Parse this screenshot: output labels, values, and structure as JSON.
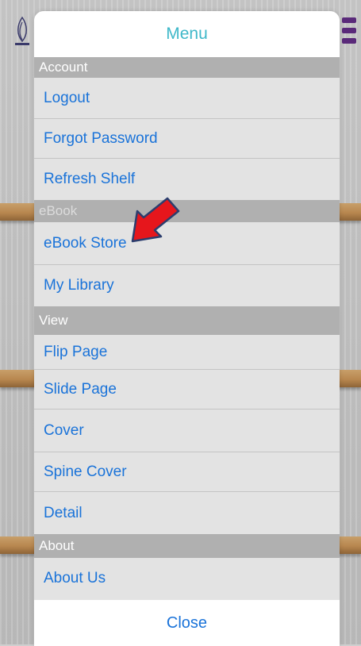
{
  "menu": {
    "title": "Menu",
    "sections": {
      "account": "Account",
      "ebook": "eBook",
      "view": "View",
      "about": "About"
    },
    "items": {
      "logout": "Logout",
      "forgot_password": "Forgot Password",
      "refresh_shelf": "Refresh Shelf",
      "ebook_store": "eBook Store",
      "my_library": "My Library",
      "flip_page": "Flip Page",
      "slide_page": "Slide Page",
      "cover": "Cover",
      "spine_cover": "Spine Cover",
      "detail": "Detail",
      "about_us": "About Us"
    },
    "close_label": "Close"
  },
  "colors": {
    "title": "#3fb8c9",
    "link": "#1a73d9",
    "section_header": "#b0b0b0",
    "annotation_arrow": "#e6161c"
  },
  "icons": [
    "app-logo-icon",
    "hamburger-menu-icon",
    "annotation-arrow-icon"
  ]
}
